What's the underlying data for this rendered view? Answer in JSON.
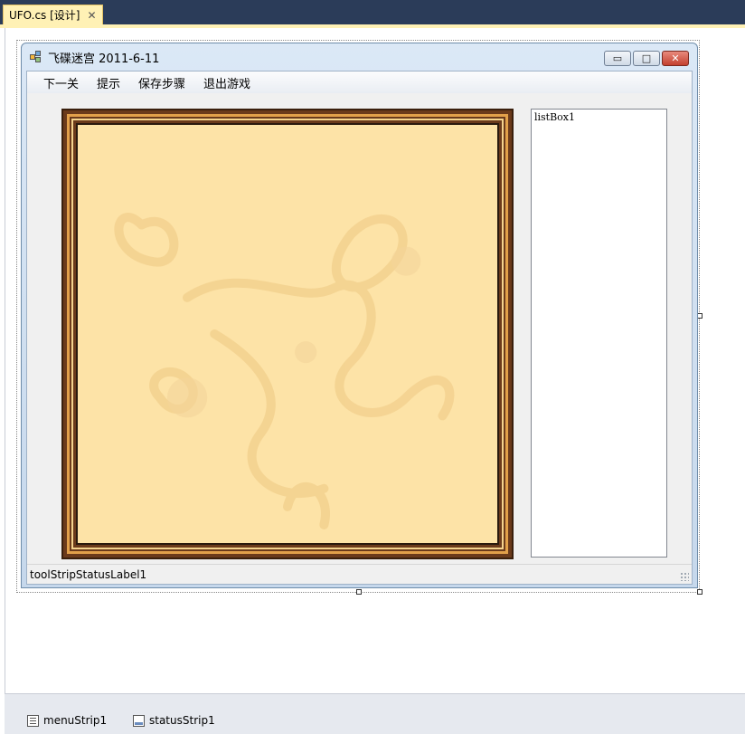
{
  "ide": {
    "tab_label": "UFO.cs [设计]",
    "tab_close": "✕"
  },
  "form": {
    "title": "飞碟迷宫 2011-6-11",
    "controls": {
      "minimize": "▭",
      "maximize": "□",
      "close": "✕"
    },
    "menu": {
      "items": [
        "下一关",
        "提示",
        "保存步骤",
        "退出游戏"
      ]
    },
    "listbox": {
      "label": "listBox1"
    },
    "status": {
      "label": "toolStripStatusLabel1"
    }
  },
  "tray": {
    "items": [
      "menuStrip1",
      "statusStrip1"
    ]
  },
  "colors": {
    "ide_tabbar": "#2b3c59",
    "tab_active": "#fff1b5",
    "board_background": "#fde3a7",
    "frame_brown": "#6b3a1b",
    "frame_orange": "#e2a04a"
  }
}
